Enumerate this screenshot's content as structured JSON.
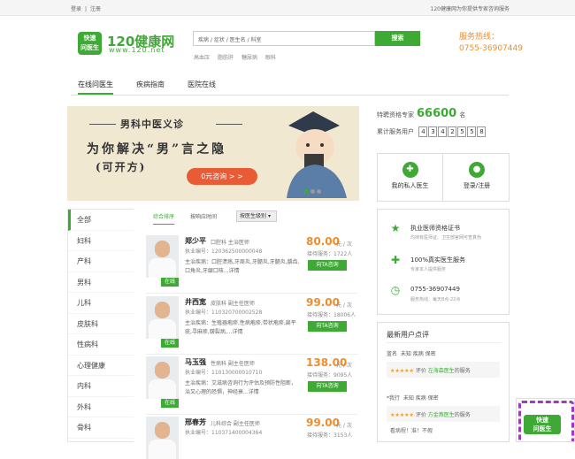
{
  "topbar": {
    "login": "登录",
    "sep": "|",
    "register": "注册",
    "right": "120健康网为你提供专家咨询服务"
  },
  "logo": {
    "badge_top": "快速",
    "badge_bottom": "问医生",
    "name": "120健康网",
    "url": "www.120.net"
  },
  "search": {
    "placeholder": "疾病 / 症状 / 医生名 / 科室",
    "button": "搜索",
    "hot": [
      "高血压",
      "脂肪肝",
      "糖尿病",
      "眼科"
    ]
  },
  "hotline": {
    "label": "服务热线：",
    "number": "0755-36907449"
  },
  "nav": {
    "items": [
      "在线问医生",
      "疾病指南",
      "医院在线"
    ]
  },
  "banner": {
    "title": "男科中医义诊",
    "line2": "为你解决“男”言之隐",
    "line3": "(可开方)",
    "cta": "0元咨询 > >"
  },
  "stats": {
    "experts_label": "特聘资格专家",
    "experts_value": "66600",
    "experts_unit": "名",
    "users_label": "累计服务用户",
    "users_digits": [
      "4",
      "3",
      "4",
      "2",
      "5",
      "5",
      "8"
    ]
  },
  "quick": {
    "doctor": "我的私人医生",
    "login": "登录/注册"
  },
  "categories": [
    "全部",
    "妇科",
    "产科",
    "男科",
    "儿科",
    "皮肤科",
    "性病科",
    "心理健康",
    "内科",
    "外科",
    "骨科"
  ],
  "list_tabs": {
    "general": "综合排序",
    "time": "按响应时间",
    "select": "按医生级别"
  },
  "doctors": [
    {
      "name": "郑少平",
      "dept": "口腔科 主治医师",
      "no": "执业编号：120362500000048",
      "spec": "主治疾病：口腔溃疡,牙周炎,牙髓炎,牙髓炎,龋齿,口角炎,牙龈口咳...",
      "more": "详情",
      "price": "80.00",
      "unit": "元 / 次",
      "served": "接待服务：1722人",
      "ask": "向TA咨询",
      "online": "在线"
    },
    {
      "name": "井西宽",
      "dept": "皮肤科 副主任医师",
      "no": "执业编号：110320700002528",
      "spec": "主治疾病：生殖器疱疹,性病疱疹,带状疱疹,扁平疣,寻麻疹,皲裂病,...",
      "more": "详情",
      "price": "99.00",
      "unit": "元 / 次",
      "served": "接待服务：18006人",
      "ask": "向TA咨询",
      "online": "在线"
    },
    {
      "name": "马玉强",
      "dept": "性病科 副主任医师",
      "no": "执业编号：110130000010710",
      "spec": "主治疾病：艾滋病咨询行为评估及预防性阻断，治又心理的恐惧，神经衰...",
      "more": "详情",
      "price": "138.00",
      "unit": "元 / 次",
      "served": "接待服务：9095人",
      "ask": "向TA咨询",
      "online": "在线"
    },
    {
      "name": "邢春芳",
      "dept": "儿科综合 副主任医师",
      "no": "执业编号：110371400004364",
      "spec": "",
      "more": "",
      "price": "99.00",
      "unit": "元 / 次",
      "served": "接待服务：3153人",
      "ask": "",
      "online": ""
    }
  ],
  "cert": [
    {
      "title": "执业医师资格证书",
      "sub": "均持有医师证、卫生部官网可查真伪"
    },
    {
      "title": "100%真实医生服务",
      "sub": "专家本人提供服务"
    },
    {
      "title": "0755-36907449",
      "sub": "服务热线：每天8点-22点"
    }
  ],
  "reviews": {
    "heading": "最新用户点评",
    "items": [
      {
        "user": "蓝名",
        "tags": "未知 疾病 保密",
        "stars": "★★★★★",
        "label": "评价",
        "doctor": "左海森医生",
        "suffix": "的服务"
      },
      {
        "user": "*我行",
        "tags": "未知 疾病 保密",
        "stars": "★★★★★",
        "label": "评价",
        "doctor": "方金燕医生",
        "suffix": "的服务"
      }
    ],
    "last_comment": "看病程！准！不假"
  },
  "qr": {
    "text_top": "快速",
    "text_bottom": "问医生"
  },
  "colors": {
    "brand": "#3eaa35",
    "price": "#f08c2a"
  }
}
